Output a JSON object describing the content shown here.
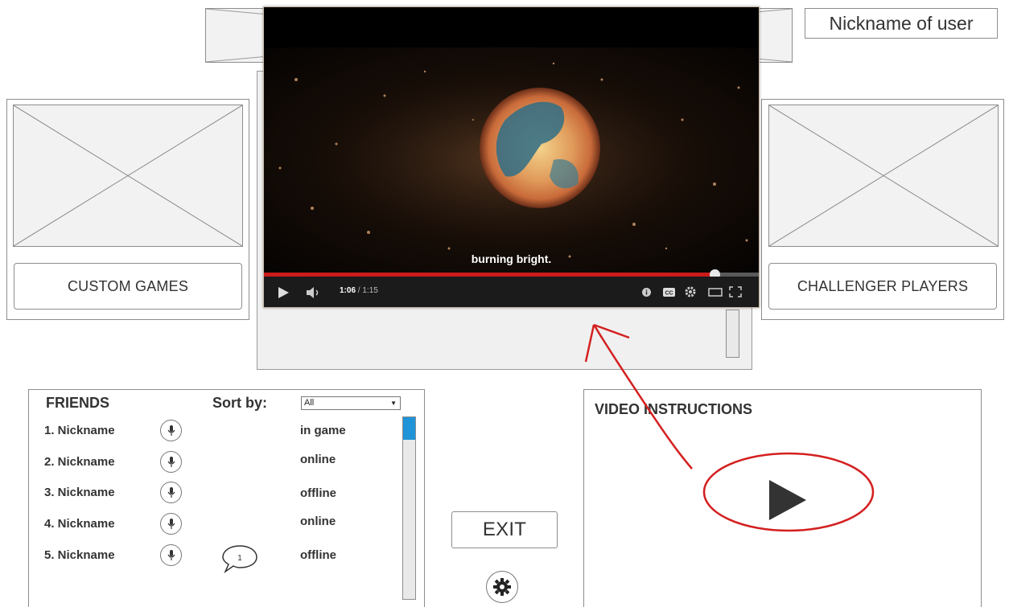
{
  "header": {
    "nickname_label": "Nickname of user"
  },
  "left_tile": {
    "label": "CUSTOM GAMES"
  },
  "right_tile": {
    "label": "CHALLENGER PLAYERS"
  },
  "video_player": {
    "subtitle": "burning bright.",
    "time_current": "1:06",
    "time_total": "/ 1:15",
    "progress": 0.91
  },
  "friends": {
    "title": "FRIENDS",
    "sort_label": "Sort by:",
    "sort_value": "All",
    "items": [
      {
        "name": "1. Nickname",
        "status": "in game"
      },
      {
        "name": "2. Nickname",
        "status": "online"
      },
      {
        "name": "3. Nickname",
        "status": "offline"
      },
      {
        "name": "4. Nickname",
        "status": "online"
      },
      {
        "name": "5. Nickname",
        "status": "offline"
      }
    ],
    "message_count": "1"
  },
  "exit_label": "EXIT",
  "video_instructions": {
    "title": "VIDEO INSTRUCTIONS"
  },
  "colors": {
    "annotation_red": "#d42020",
    "progress_red": "#cc1b1b",
    "scroll_thumb_blue": "#1f94d8"
  },
  "icons": [
    "play-icon",
    "volume-icon",
    "info-icon",
    "cc-icon",
    "settings-icon",
    "theater-icon",
    "fullscreen-icon",
    "mic-icon",
    "chat-bubble-icon",
    "gear-icon",
    "play-triangle-icon"
  ]
}
